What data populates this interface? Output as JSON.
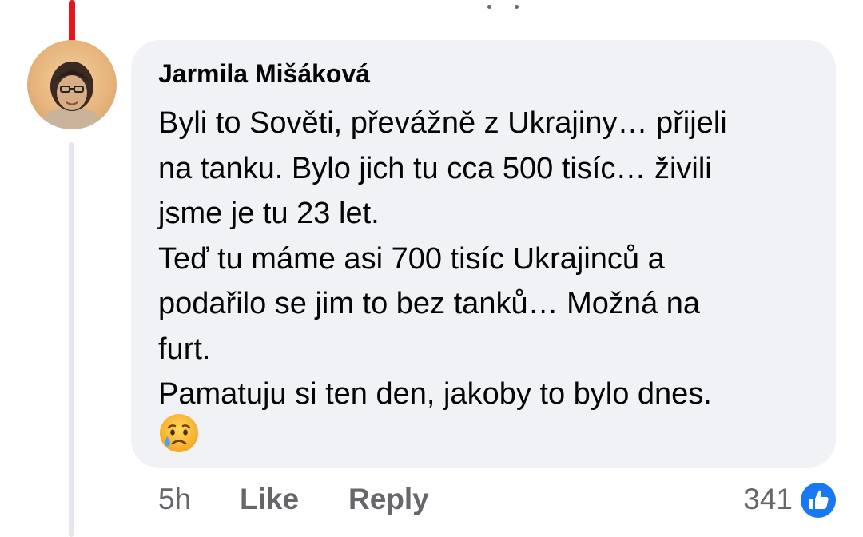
{
  "comment": {
    "author": "Jarmila Mišáková",
    "text_lines": [
      "Byli to Sověti, převážně z Ukrajiny… přijeli",
      "na tanku. Bylo jich tu cca 500 tisíc… živili",
      "jsme je tu 23 let.",
      "Teď tu máme asi 700 tisíc Ukrajinců a",
      "podařilo se jim to bez tanků… Možná na",
      "furt.",
      "Pamatuju si ten den, jakoby to bylo dnes."
    ],
    "emoji": "sad-tear-emoji"
  },
  "actions": {
    "time": "5h",
    "like_label": "Like",
    "reply_label": "Reply"
  },
  "reactions": {
    "count": "341",
    "icon": "like-reaction-icon"
  },
  "colors": {
    "bubble_bg": "#f0f2f5",
    "meta_text": "#65676b",
    "like_blue": "#1877f2",
    "thread_red": "#e8141c"
  }
}
